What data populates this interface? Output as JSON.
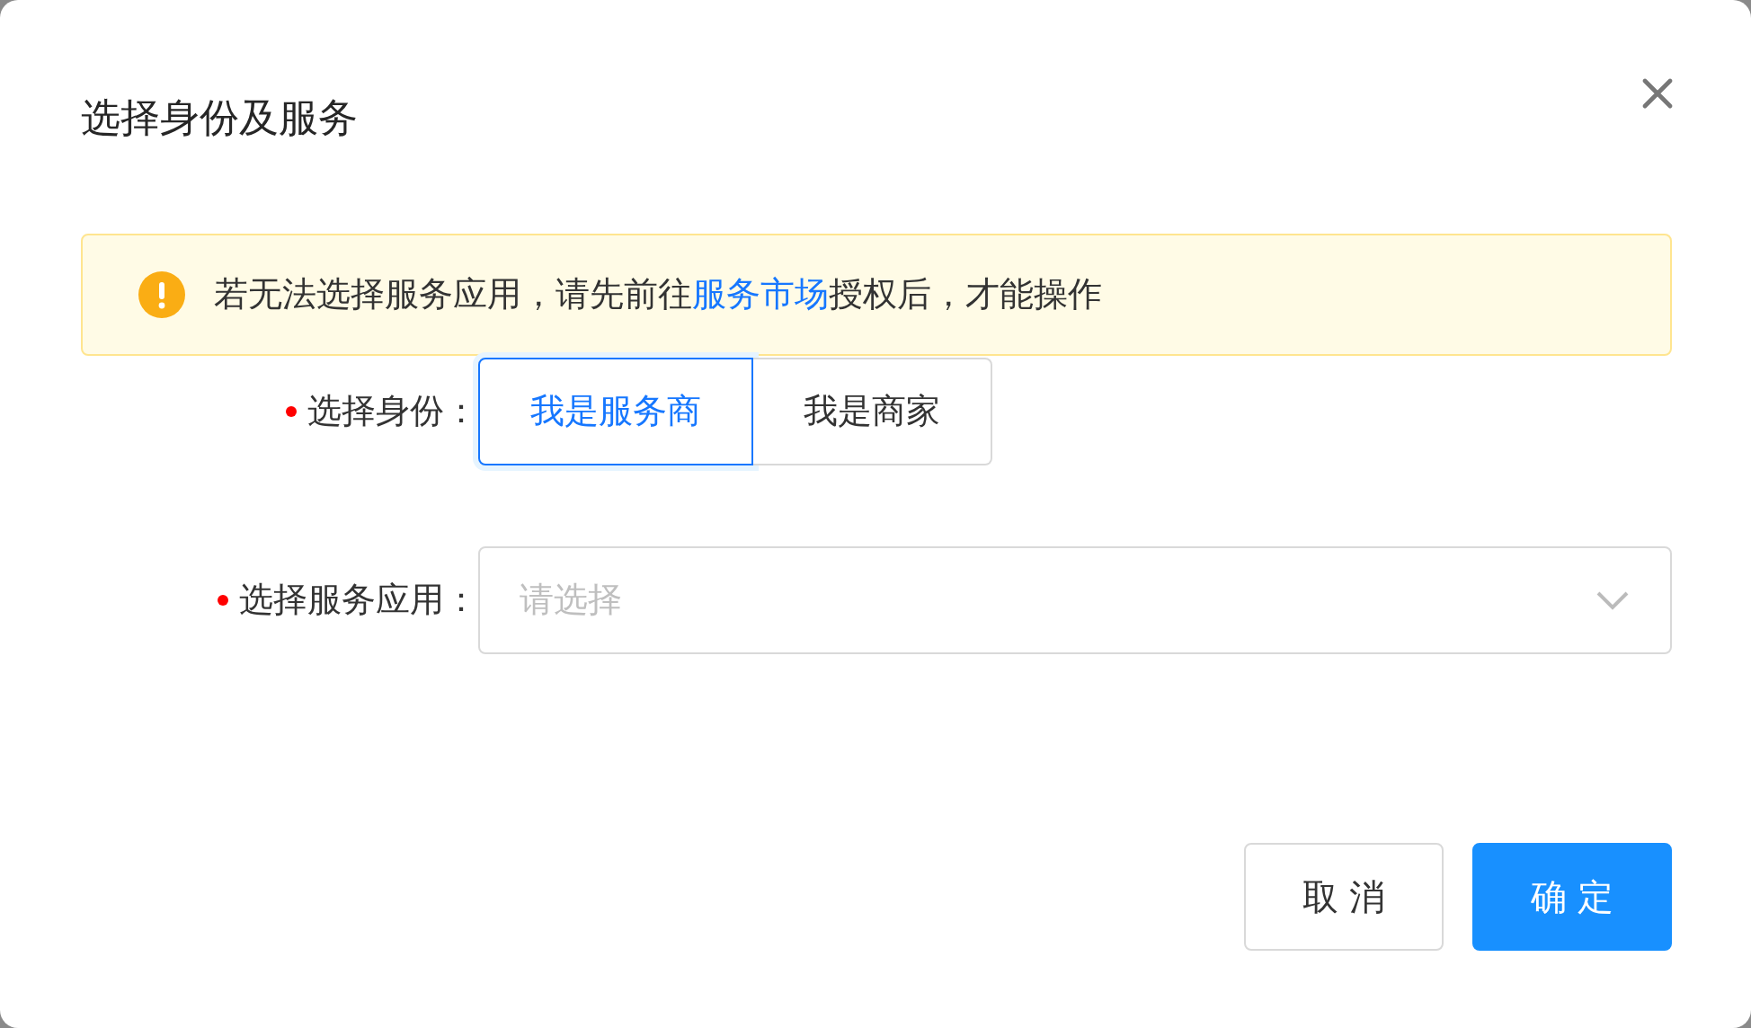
{
  "dialog": {
    "title": "选择身份及服务"
  },
  "alert": {
    "before": "若无法选择服务应用，请先前往",
    "link": "服务市场",
    "after": "授权后，才能操作"
  },
  "form": [
    {
      "kind": "segmented",
      "label": "选择身份：",
      "required": true,
      "options": [
        {
          "label": "我是服务商",
          "selected": true
        },
        {
          "label": "我是商家",
          "selected": false
        }
      ]
    },
    {
      "kind": "select",
      "label": "选择服务应用：",
      "required": true,
      "placeholder": "请选择"
    }
  ],
  "buttons": [
    {
      "label": "取 消",
      "kind": "default"
    },
    {
      "label": "确 定",
      "kind": "primary"
    }
  ]
}
